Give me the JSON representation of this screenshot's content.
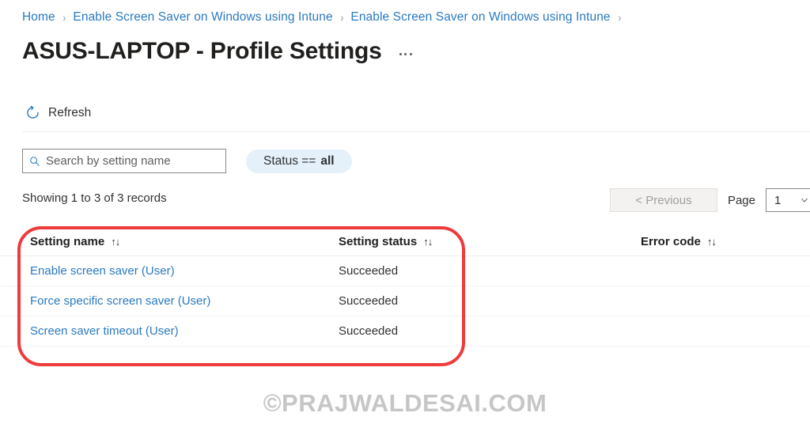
{
  "breadcrumb": {
    "separator": "›",
    "items": [
      {
        "label": "Home"
      },
      {
        "label": "Enable Screen Saver on Windows using Intune"
      },
      {
        "label": "Enable Screen Saver on Windows using Intune"
      }
    ]
  },
  "header": {
    "title": "ASUS-LAPTOP - Profile Settings",
    "more_menu": "more-options"
  },
  "commandbar": {
    "refresh_label": "Refresh",
    "refresh_icon": "refresh-icon",
    "accent_color": "#2a7ac0"
  },
  "filters": {
    "search": {
      "placeholder": "Search by setting name",
      "value": "",
      "icon": "search-icon"
    },
    "status_pill": {
      "prefix": "Status ==",
      "value": "all",
      "background": "#e4f1fb"
    }
  },
  "pagination": {
    "records_text": "Showing 1 to 3 of 3 records",
    "previous_label": "< Previous",
    "previous_disabled": true,
    "page_label": "Page",
    "page_value": "1",
    "chevron_icon": "chevron-down-icon"
  },
  "table": {
    "sort_glyph": "↑↓",
    "columns": [
      {
        "label": "Setting name"
      },
      {
        "label": "Setting status"
      },
      {
        "label": "Error code"
      }
    ],
    "rows": [
      {
        "name": "Enable screen saver (User)",
        "status": "Succeeded",
        "error": ""
      },
      {
        "name": "Force specific screen saver (User)",
        "status": "Succeeded",
        "error": ""
      },
      {
        "name": "Screen saver timeout (User)",
        "status": "Succeeded",
        "error": ""
      }
    ]
  },
  "annotation": {
    "color": "#ee3b3b"
  },
  "watermark": {
    "text": "©PRAJWALDESAI.COM"
  }
}
